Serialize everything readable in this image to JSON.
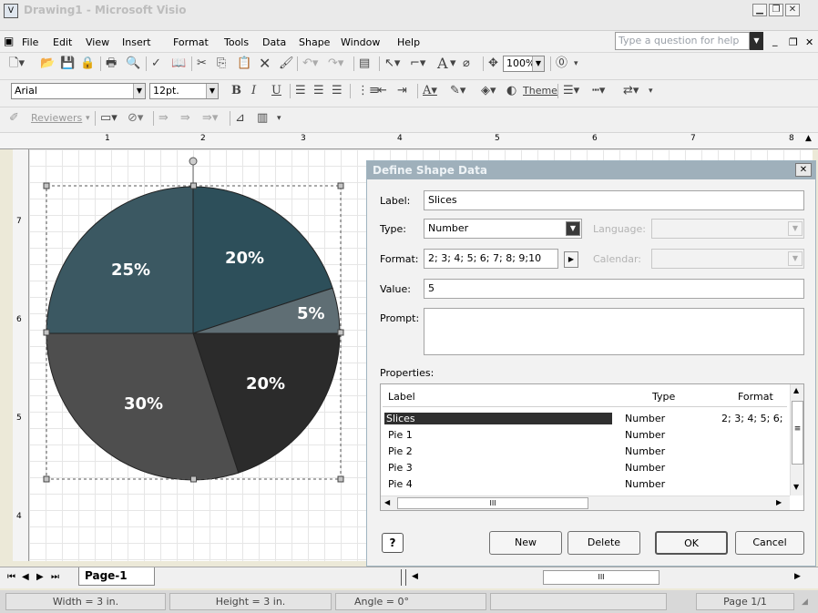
{
  "window": {
    "title": "Drawing1 - Microsoft Visio",
    "app_icon": "visio-app-icon"
  },
  "menubar": {
    "items": [
      "File",
      "Edit",
      "View",
      "Insert",
      "Format",
      "Tools",
      "Data",
      "Shape",
      "Window",
      "Help"
    ],
    "help_placeholder": "Type a question for help"
  },
  "toolbar_standard": {
    "zoom": "100%",
    "text_tool": "A"
  },
  "toolbar_formatting": {
    "font": "Arial",
    "size": "12pt.",
    "bold": "B",
    "italic": "I",
    "underline": "U",
    "theme": "Theme"
  },
  "toolbar_reviewing": {
    "reviewers": "Reviewers"
  },
  "ruler": {
    "h_marks": [
      "1",
      "2",
      "3",
      "4",
      "5",
      "6",
      "7",
      "8"
    ],
    "v_marks": [
      "7",
      "6",
      "5",
      "4"
    ]
  },
  "pie": {
    "slices": [
      {
        "label": "20%",
        "value": 20,
        "color": "#2d4f5a"
      },
      {
        "label": "5%",
        "value": 5,
        "color": "#5f6e74"
      },
      {
        "label": "20%",
        "value": 20,
        "color": "#2b2b2b"
      },
      {
        "label": "30%",
        "value": 30,
        "color": "#4e4e4e"
      },
      {
        "label": "25%",
        "value": 25,
        "color": "#3b5862"
      }
    ]
  },
  "dialog": {
    "title": "Define Shape Data",
    "close": "✕",
    "label_caption": "Label:",
    "label_value": "Slices",
    "type_caption": "Type:",
    "type_value": "Number",
    "language_caption": "Language:",
    "format_caption": "Format:",
    "format_value": "2; 3; 4; 5; 6; 7; 8; 9;10",
    "calendar_caption": "Calendar:",
    "value_caption": "Value:",
    "value_value": "5",
    "prompt_caption": "Prompt:",
    "prompt_value": "",
    "properties_caption": "Properties:",
    "columns": [
      "Label",
      "Type",
      "Format"
    ],
    "rows": [
      {
        "label": "Slices",
        "type": "Number",
        "format": "2; 3; 4; 5; 6;"
      },
      {
        "label": "Pie 1",
        "type": "Number",
        "format": ""
      },
      {
        "label": "Pie 2",
        "type": "Number",
        "format": ""
      },
      {
        "label": "Pie 3",
        "type": "Number",
        "format": ""
      },
      {
        "label": "Pie 4",
        "type": "Number",
        "format": ""
      }
    ],
    "scroll_thumb": "III",
    "buttons": {
      "new": "New",
      "delete": "Delete",
      "ok": "OK",
      "cancel": "Cancel"
    }
  },
  "tabs": {
    "page": "Page-1",
    "hscroll_thumb": "III"
  },
  "status": {
    "width": "Width = 3 in.",
    "height": "Height = 3 in.",
    "angle": "Angle = 0°",
    "page": "Page 1/1"
  }
}
